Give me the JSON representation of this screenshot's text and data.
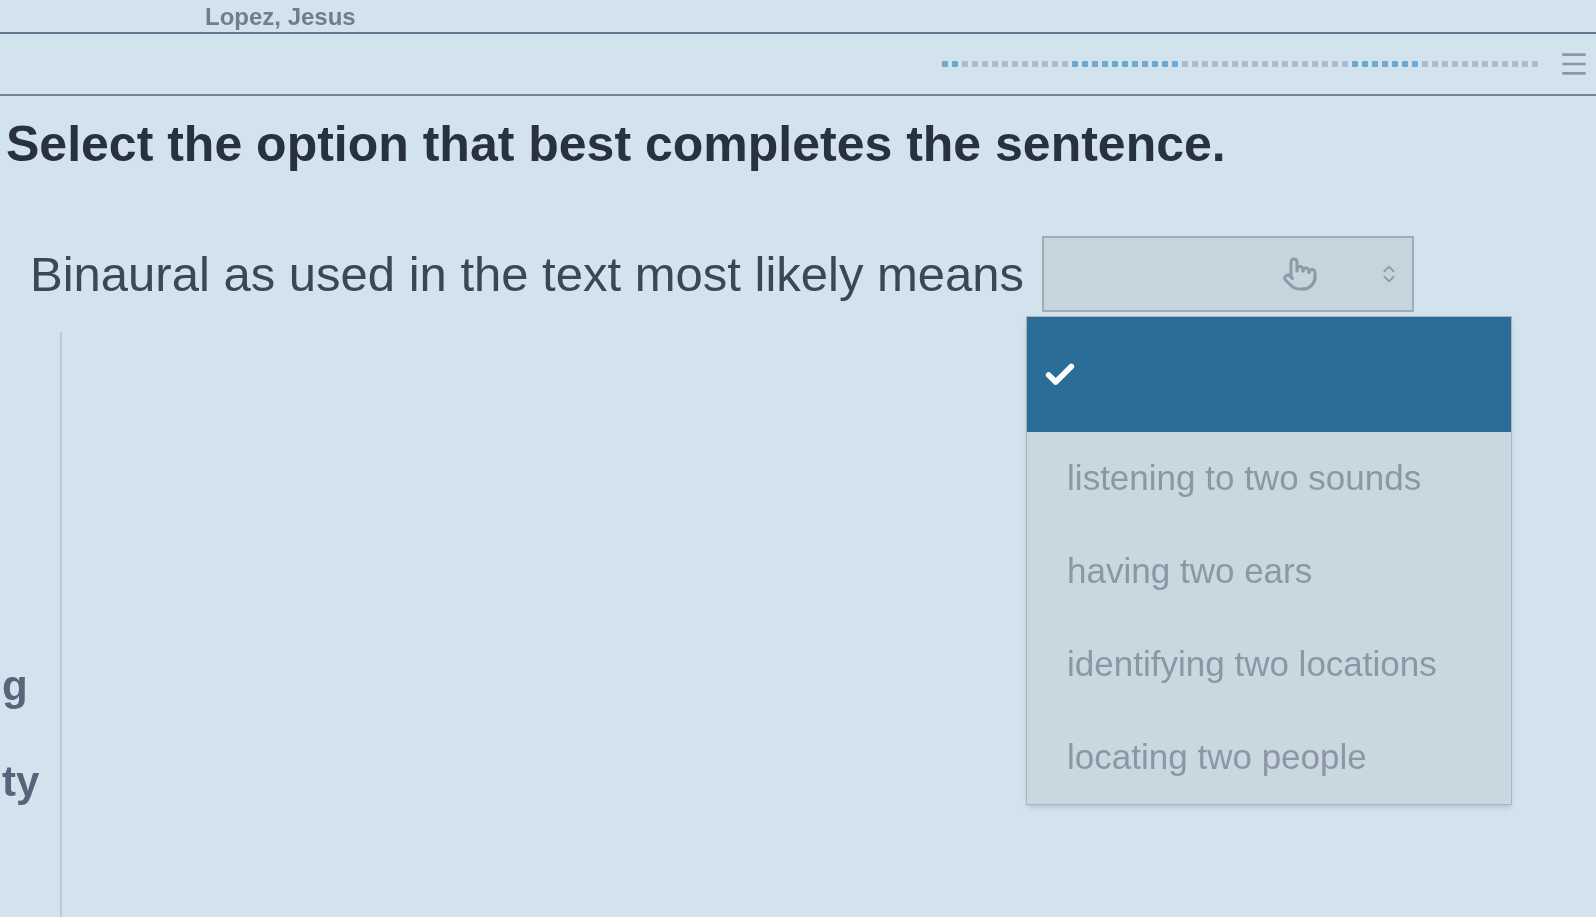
{
  "header": {
    "user_name": "Lopez, Jesus"
  },
  "instruction": "Select the option that best completes the sentence.",
  "question": {
    "prompt": "Binaural as used in the text most likely means",
    "dropdown": {
      "expanded": true,
      "options": [
        {
          "selected": true
        },
        {
          "label": "listening to two sounds",
          "selected": false
        },
        {
          "label": "having two ears",
          "selected": false
        },
        {
          "label": "identifying two locations",
          "selected": false
        },
        {
          "label": "locating two people",
          "selected": false
        }
      ]
    }
  },
  "sidebar": {
    "items": [
      "g",
      "ty"
    ]
  }
}
